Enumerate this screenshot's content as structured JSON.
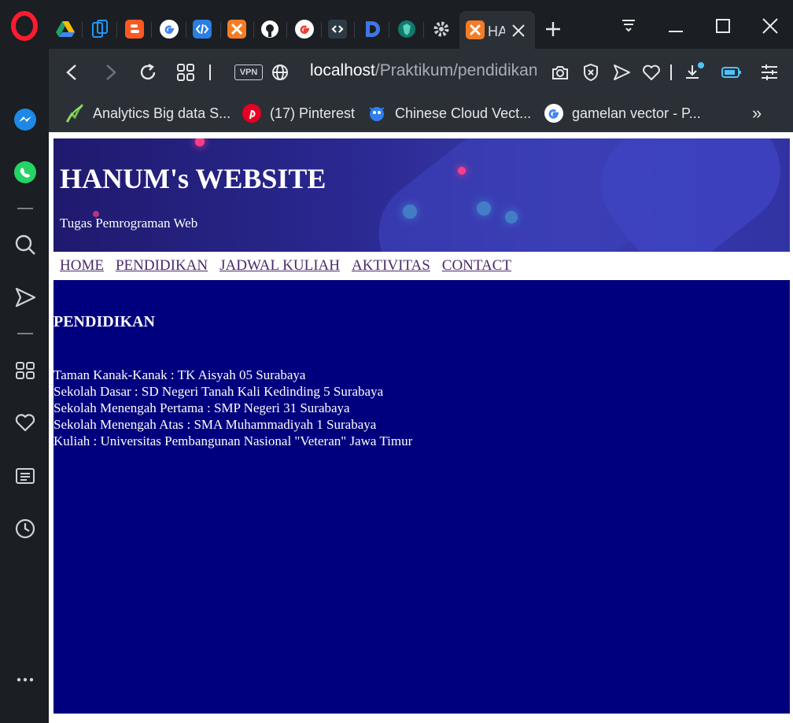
{
  "browser": {
    "active_tab_title": "HA",
    "url_host": "localhost",
    "url_path": "/Praktikum/pendidikan",
    "vpn_label": "VPN",
    "bookmarks": [
      {
        "label": "Analytics Big data S...",
        "icon": "analytics-icon"
      },
      {
        "label": "(17) Pinterest",
        "icon": "pinterest-icon"
      },
      {
        "label": "Chinese Cloud Vect...",
        "icon": "cloud-icon"
      },
      {
        "label": "gamelan vector - P...",
        "icon": "google-icon"
      }
    ],
    "bookmarks_overflow": "»",
    "colors": {
      "frame": "#1b1e23",
      "toolbar": "#2b2f36",
      "accent": "#4fc3f7"
    }
  },
  "page": {
    "site_title": "HANUM's WEBSITE",
    "site_subtitle": "Tugas Pemrograman Web",
    "nav": [
      "HOME",
      "PENDIDIKAN",
      "JADWAL KULIAH",
      "AKTIVITAS",
      "CONTACT"
    ],
    "section_heading": "PENDIDIKAN",
    "education": [
      "Taman Kanak-Kanak : TK Aisyah 05 Surabaya",
      "Sekolah Dasar : SD Negeri Tanah Kali Kedinding 5 Surabaya",
      "Sekolah Menengah Pertama : SMP Negeri 31 Surabaya",
      "Sekolah Menengah Atas : SMA Muhammadiyah 1 Surabaya",
      "Kuliah : Universitas Pembangunan Nasional \"Veteran\" Jawa Timur"
    ],
    "colors": {
      "content_bg": "#00007f",
      "nav_link": "#4b2a6a"
    }
  }
}
